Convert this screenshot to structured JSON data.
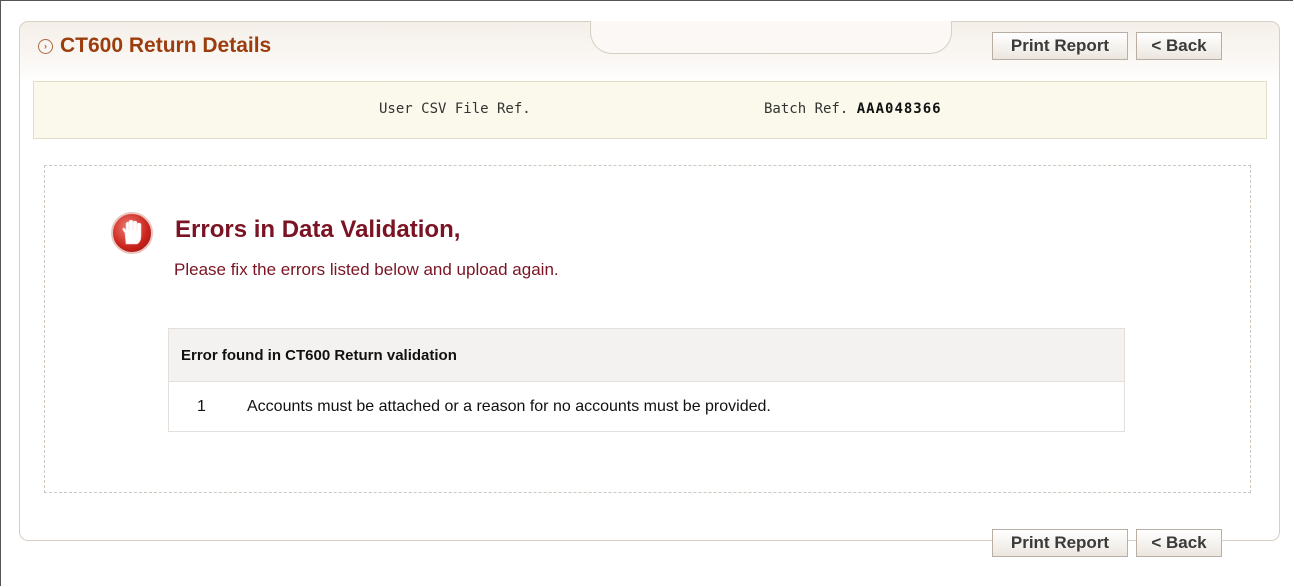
{
  "header": {
    "title": "CT600 Return Details",
    "print_label": "Print Report",
    "back_label": "< Back"
  },
  "refs": {
    "user_csv_label": "User CSV File Ref.",
    "batch_label": "Batch Ref.",
    "batch_value": "AAA048366"
  },
  "error": {
    "title": "Errors in Data Validation,",
    "subtitle": "Please fix the errors listed below and upload again.",
    "icon": "stop-hand-icon",
    "table_header": "Error found in CT600 Return validation",
    "rows": [
      {
        "num": "1",
        "message": "Accounts must be attached or a reason for no accounts must be provided."
      }
    ]
  },
  "colors": {
    "title": "#9c3d0e",
    "error_text": "#7a1424",
    "ref_bar_bg": "#fbf9ec"
  }
}
